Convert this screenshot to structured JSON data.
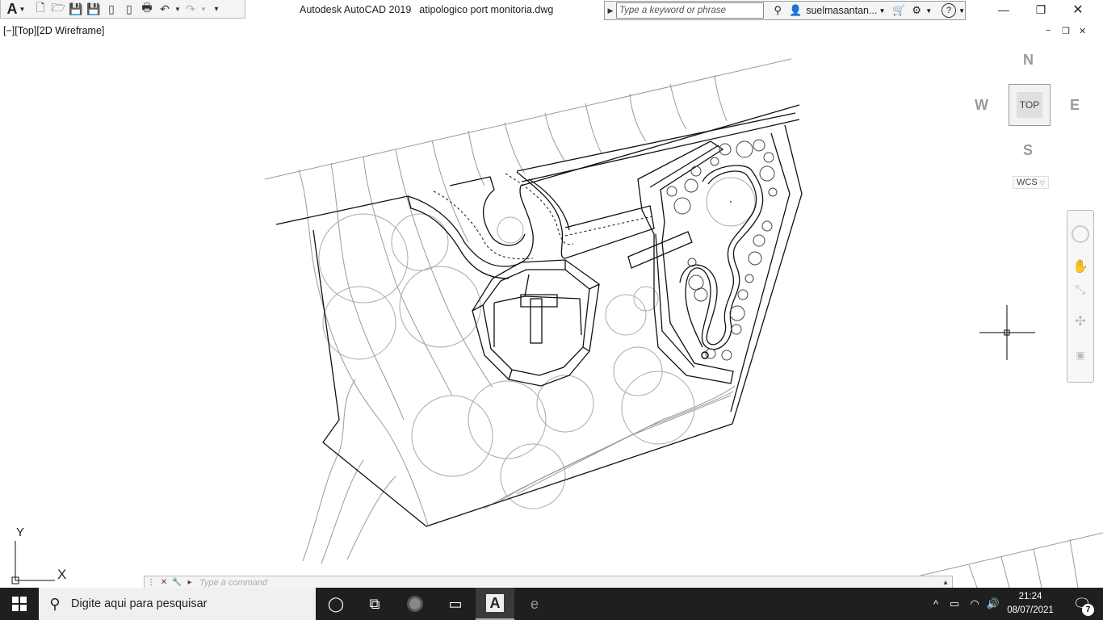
{
  "window": {
    "app_title": "Autodesk AutoCAD 2019",
    "file_name": "atipologico port monitoria.dwg",
    "minimize_icon": "minimize-icon",
    "maximize_icon": "restore-icon",
    "close_icon": "close-icon"
  },
  "quick_access": {
    "app_letter": "A",
    "icons": [
      "new-icon",
      "open-icon",
      "save-icon",
      "save-as-icon",
      "open-web-icon",
      "save-web-icon",
      "plot-icon",
      "undo-icon",
      "redo-icon",
      "customize-icon"
    ]
  },
  "search": {
    "placeholder": "Type a keyword or phrase",
    "user_name": "suelmasantan...",
    "icons": [
      "binoculars-icon",
      "user-icon",
      "cart-icon",
      "autodesk-app-icon",
      "help-icon"
    ]
  },
  "viewport": {
    "label": "[−][Top][2D Wireframe]",
    "controls": [
      "−",
      "❐",
      "✕"
    ]
  },
  "viewcube": {
    "north": "N",
    "south": "S",
    "east": "E",
    "west": "W",
    "face": "TOP",
    "wcs": "WCS"
  },
  "ucs": {
    "y_label": "Y",
    "x_label": "X"
  },
  "command_line": {
    "placeholder": "Type a command"
  },
  "taskbar": {
    "search_text": "Digite aqui para pesquisar",
    "time": "21:24",
    "date": "08/07/2021",
    "notification_count": "7",
    "apps": [
      "cortana-icon",
      "task-view-icon",
      "chrome-icon",
      "file-explorer-icon",
      "autocad-icon",
      "edge-icon"
    ]
  },
  "colors": {
    "taskbar_bg": "#1f1f1f",
    "canvas_bg": "#ffffff",
    "drawing_line": "#111111",
    "contour_line": "#999999"
  }
}
